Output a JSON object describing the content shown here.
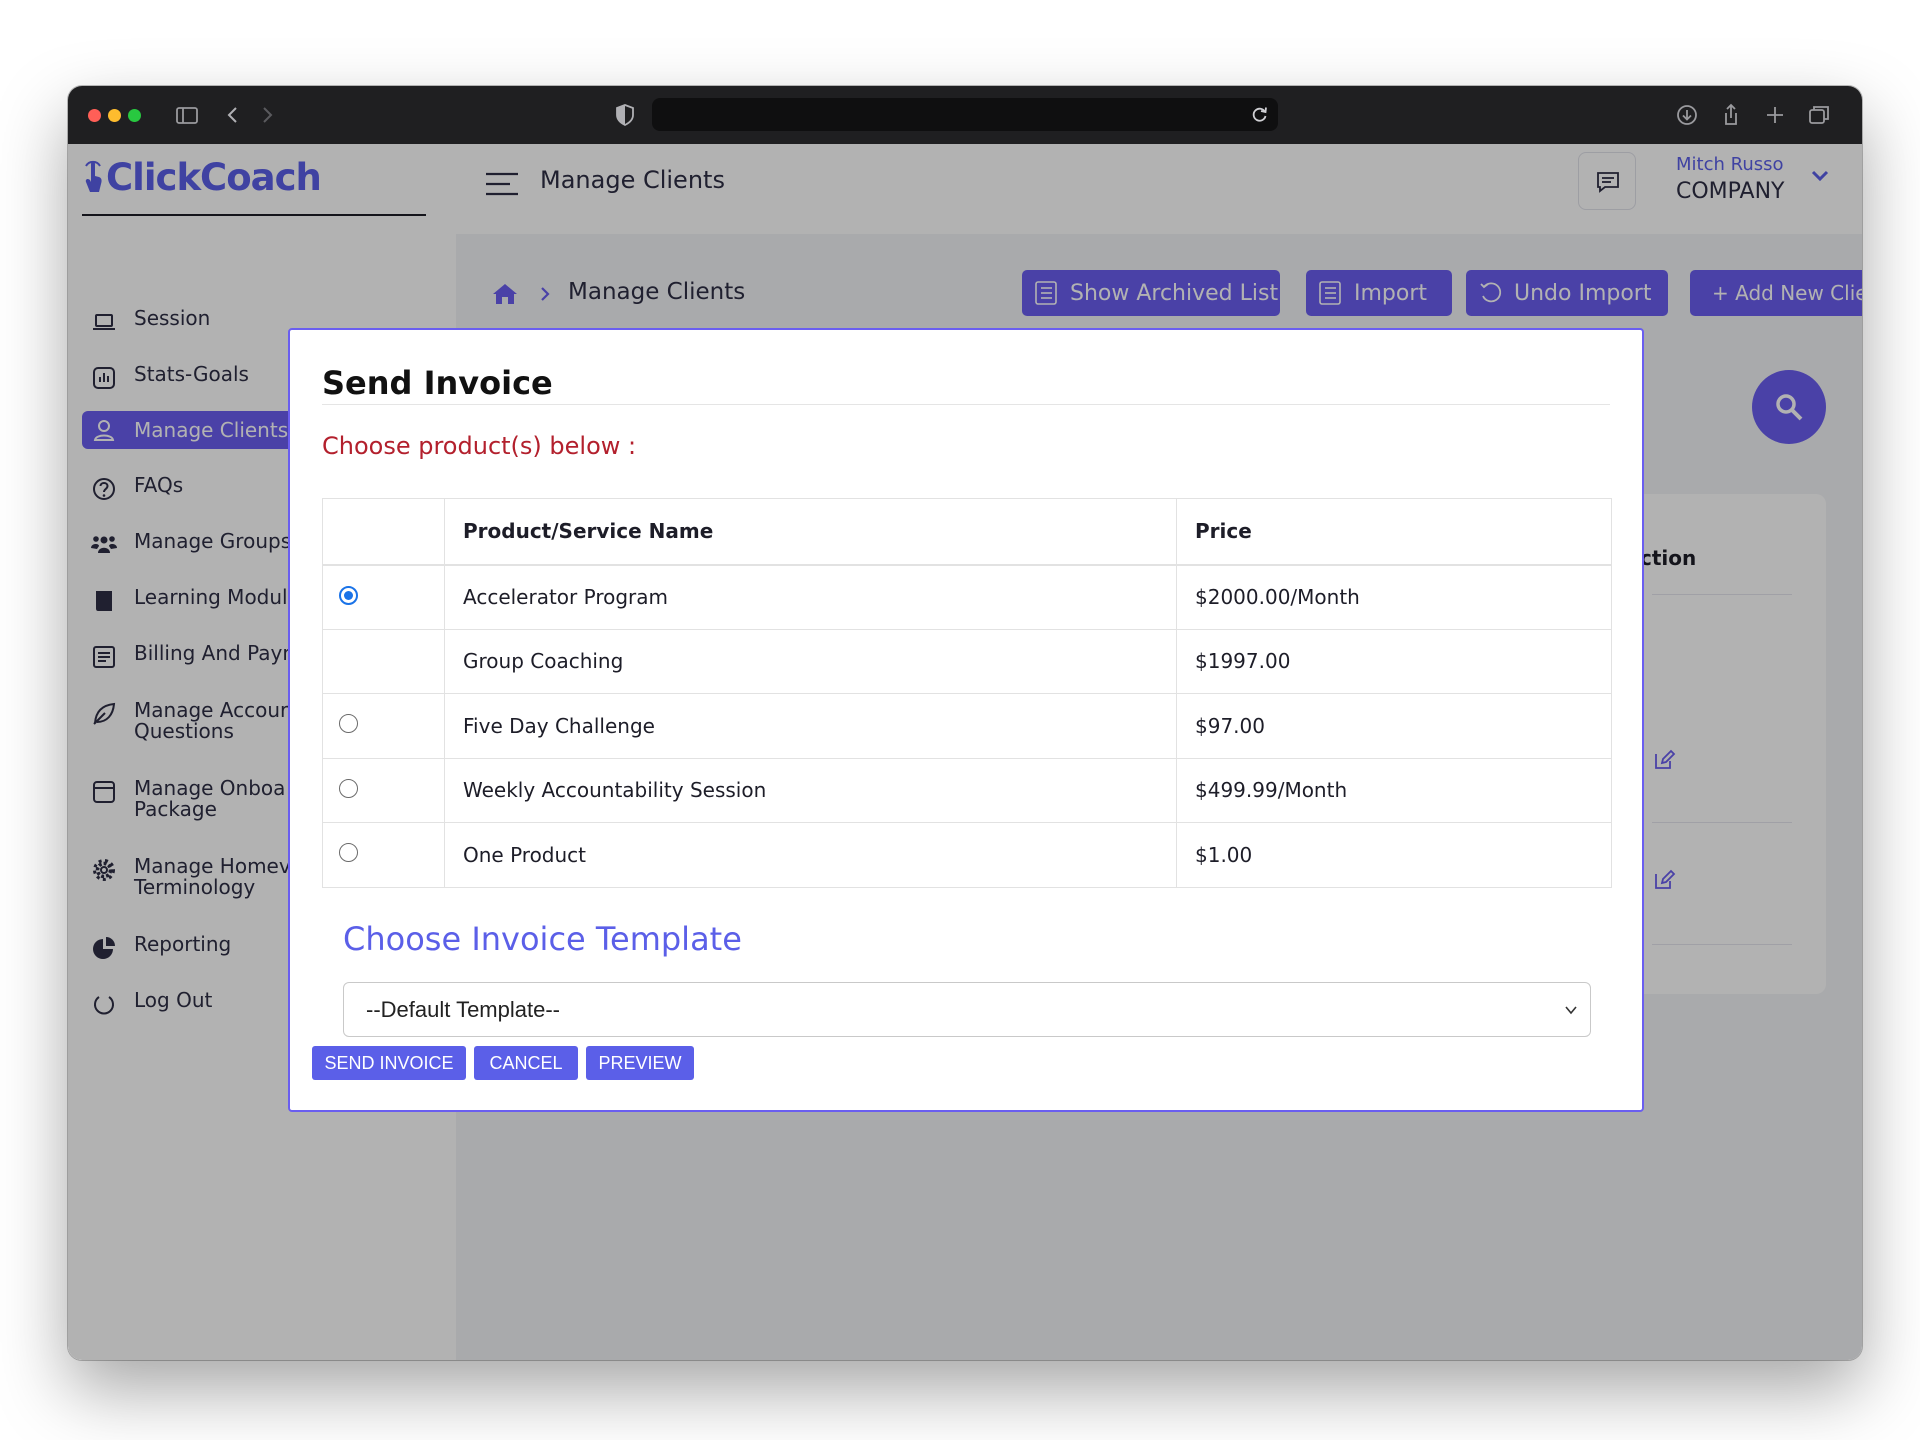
{
  "app": {
    "logo_text": "ClickCoach",
    "top_title": "Manage Clients",
    "user_name": "Mitch Russo",
    "user_company": "COMPANY",
    "accent_color": "#6a5ef0"
  },
  "sidebar": {
    "items": [
      {
        "label": "Session",
        "icon": "laptop-icon"
      },
      {
        "label": "Stats-Goals",
        "icon": "stats-icon"
      },
      {
        "label": "Manage Clients",
        "icon": "user-icon",
        "active": true
      },
      {
        "label": "FAQs",
        "icon": "question-icon"
      },
      {
        "label": "Manage Groups",
        "icon": "group-icon"
      },
      {
        "label": "Learning Module",
        "icon": "book-icon"
      },
      {
        "label": "Billing And Payn",
        "icon": "receipt-icon"
      },
      {
        "label": "Manage Accour",
        "label2": "Questions",
        "icon": "leaf-icon"
      },
      {
        "label": "Manage Onboa",
        "label2": "Package",
        "icon": "package-icon"
      },
      {
        "label": "Manage Homev",
        "label2": "Terminology",
        "icon": "gear-icon"
      },
      {
        "label": "Reporting",
        "icon": "pie-icon"
      },
      {
        "label": "Log Out",
        "icon": "power-icon"
      }
    ]
  },
  "breadcrumb": {
    "current": "Manage Clients"
  },
  "toolbar": {
    "show_archived": "Show Archived List",
    "import": "Import",
    "undo_import": "Undo Import",
    "add_client": "+ Add New Client"
  },
  "background": {
    "action_header": "ction"
  },
  "modal": {
    "title": "Send Invoice",
    "subtitle": "Choose product(s) below :",
    "columns": {
      "name": "Product/Service Name",
      "price": "Price"
    },
    "products": [
      {
        "name": "Accelerator Program",
        "price": "$2000.00/Month",
        "radio": true,
        "selected": true
      },
      {
        "name": "Group Coaching",
        "price": "$1997.00",
        "radio": false,
        "selected": false
      },
      {
        "name": "Five Day Challenge",
        "price": "$97.00",
        "radio": true,
        "selected": false
      },
      {
        "name": "Weekly Accountability Session",
        "price": "$499.99/Month",
        "radio": true,
        "selected": false
      },
      {
        "name": "One Product",
        "price": "$1.00",
        "radio": true,
        "selected": false
      }
    ],
    "template_heading": "Choose Invoice Template",
    "template_selected": "--Default Template--",
    "buttons": {
      "send": "SEND INVOICE",
      "cancel": "CANCEL",
      "preview": "PREVIEW"
    }
  }
}
